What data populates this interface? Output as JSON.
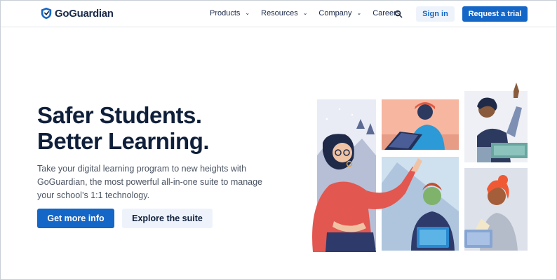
{
  "brand": {
    "logo_text": "GoGuardian",
    "icon": "shield-icon",
    "accent": "#1466c7",
    "dark": "#0f1f3a"
  },
  "nav": {
    "items": [
      {
        "label": "Products",
        "has_dropdown": true
      },
      {
        "label": "Resources",
        "has_dropdown": true
      },
      {
        "label": "Company",
        "has_dropdown": true
      },
      {
        "label": "Careers",
        "has_dropdown": false
      }
    ],
    "chevron": "⌄",
    "search_icon": "search-icon",
    "sign_in": "Sign in",
    "request_trial": "Request a trial"
  },
  "hero": {
    "headline_line1": "Safer Students.",
    "headline_line2": "Better Learning.",
    "subtitle": "Take your digital learning program to new heights with GoGuardian, the most powerful all-in-one suite to manage your school’s 1:1 technology.",
    "cta_primary": "Get more info",
    "cta_secondary": "Explore the suite"
  },
  "illustration": {
    "subject": "students-collage-illustration"
  }
}
